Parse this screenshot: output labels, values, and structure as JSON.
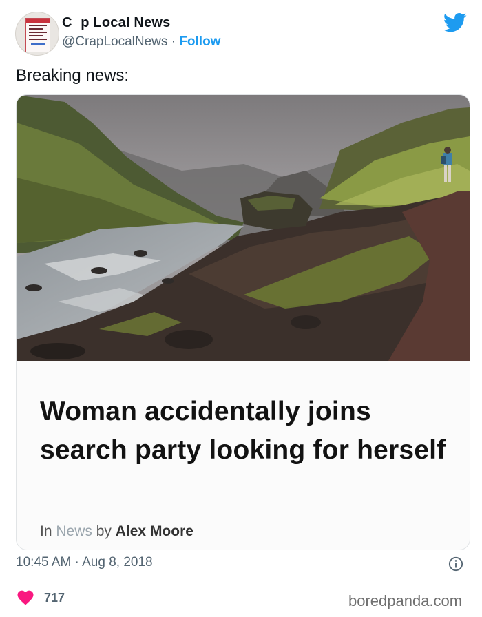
{
  "author": {
    "display_name": "C   p Local News",
    "handle": "@CrapLocalNews",
    "separator": "·",
    "follow_label": "Follow"
  },
  "tweet": {
    "text": "Breaking news:",
    "timestamp": "10:45 AM · Aug 8, 2018",
    "likes": "717"
  },
  "article": {
    "headline": "Woman accidentally joins search party looking for herself",
    "byline_prefix": "In",
    "byline_category": "News",
    "byline_middle": "by",
    "byline_author": "Alex Moore"
  },
  "watermark": "boredpanda.com",
  "icons": {
    "brand": "twitter-bird-icon",
    "info": "info-icon",
    "like": "heart-icon"
  },
  "colors": {
    "brand_blue": "#1d9bf0",
    "like_red": "#f91880",
    "text_primary": "#0f1419",
    "text_secondary": "#536471"
  }
}
